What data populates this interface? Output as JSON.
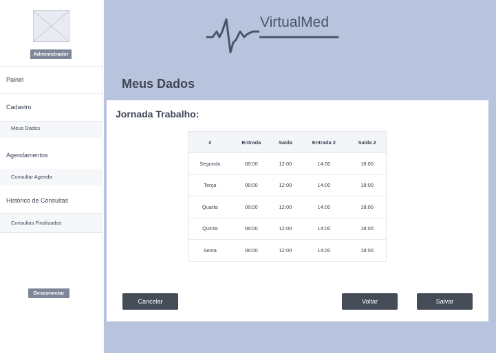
{
  "sidebar": {
    "role_badge": "Administrador",
    "items": {
      "painel": "Painel",
      "cadastro": "Cadastro",
      "meus_dados": "Meus Dados",
      "agendamentos": "Agendamentos",
      "consultar_agenda": "Consultar Agenda",
      "historico": "Histórico de Consultas",
      "consultas_finalizadas": "Consultas Finalizadas"
    },
    "logout": "Desconectar"
  },
  "header": {
    "brand": "VirtualMed"
  },
  "main": {
    "title": "Meus Dados",
    "section_title": "Jornada Trabalho:",
    "table": {
      "headers": [
        "#",
        "Entrada",
        "Saída",
        "Entrada 2",
        "Saída 2"
      ],
      "rows": [
        [
          "Segunda",
          "08:00",
          "12:00",
          "14:00",
          "18:00"
        ],
        [
          "Terça",
          "08:00",
          "12:00",
          "14:00",
          "18:00"
        ],
        [
          "Quarta",
          "08:00",
          "12:00",
          "14:00",
          "18:00"
        ],
        [
          "Quinta",
          "08:00",
          "12:00",
          "14:00",
          "18:00"
        ],
        [
          "Sexta",
          "08:00",
          "12:00",
          "14:00",
          "18:00"
        ]
      ]
    },
    "buttons": {
      "cancel": "Cancelar",
      "back": "Voltar",
      "save": "Salvar"
    }
  },
  "colors": {
    "main_bg": "#b8c4de",
    "button": "#454c58",
    "badge": "#7d8798"
  }
}
